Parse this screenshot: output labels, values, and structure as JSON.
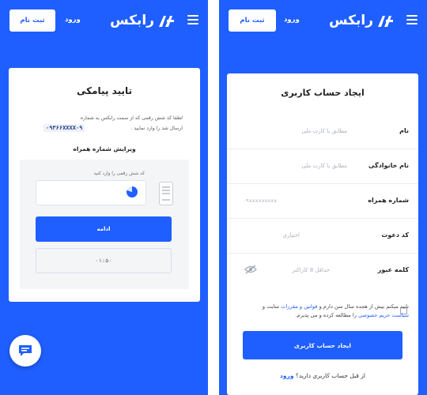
{
  "header": {
    "register_label": "ثبت نام",
    "login_label": "ورود",
    "logo_text": "رابکس",
    "menu_icon": "hamburger-icon"
  },
  "otp": {
    "title": "تایید پیامکی",
    "instruction": "لطفا کد شش رقمی که از سمت رابکس به شماره",
    "instruction_tail": "ارسال شد را وارد نمایید .",
    "phone": "۰۹۳۶۶XXXX۰۹",
    "edit_phone": "ویرایش شماره همراه",
    "input_hint": "کد شش رقمی را وارد کنید",
    "continue_label": "ادامه",
    "timer": "۰۱:۵۰"
  },
  "signup": {
    "title": "ایجاد حساب کاربری",
    "fields": [
      {
        "label": "نام",
        "placeholder": "مطابق با کارت ملی"
      },
      {
        "label": "نام خانوادگی",
        "placeholder": "مطابق با کارت ملی"
      },
      {
        "label": "شماره همراه",
        "placeholder": "۰۹xxxxxxxxx"
      },
      {
        "label": "کد دعوت",
        "placeholder": "اختیاری"
      },
      {
        "label": "کلمه عبور",
        "placeholder": "حداقل 8 کاراکتر"
      }
    ],
    "terms_prefix": "تایید میکنم بیش از هجده سال سن دارم و",
    "terms_link1": "قوانین و مقررات",
    "terms_mid": "سایت و",
    "terms_link2": "سیاست حریم خصوصی",
    "terms_suffix": "را مطالعه کرده و می پذیرم.",
    "submit_label": "ایجاد حساب کاربری",
    "already_prefix": "از قبل حساب کاربری دارید؟",
    "already_link": "ورود"
  },
  "colors": {
    "accent": "#1f5fff"
  }
}
